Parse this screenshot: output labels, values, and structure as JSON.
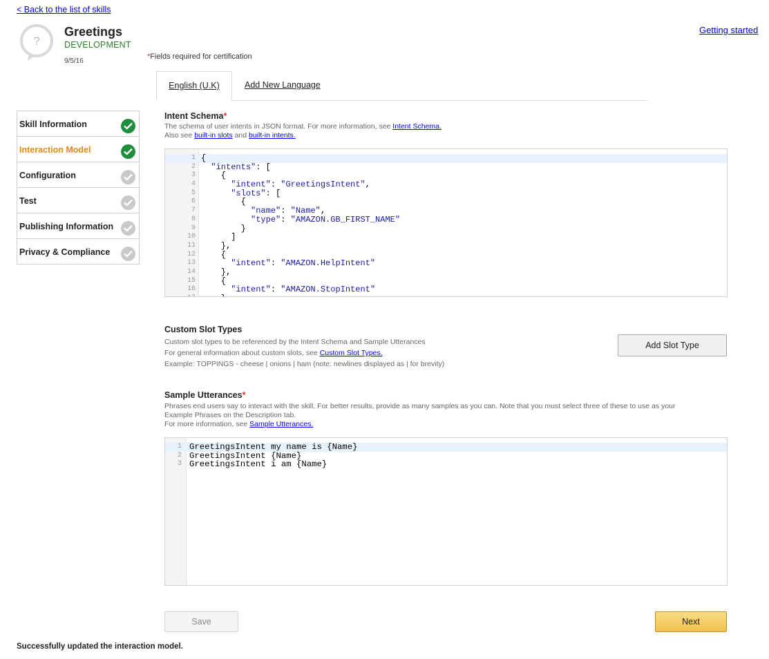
{
  "header": {
    "back_link": "< Back to the list of skills",
    "skill_name": "Greetings",
    "skill_status": "DEVELOPMENT",
    "skill_date": "9/5/16",
    "getting_started": "Getting started",
    "required_mark": "*",
    "required_note": "Fields required for certification"
  },
  "language_tabs": [
    {
      "label": "English (U.K)",
      "active": true
    },
    {
      "label": "Add New Language",
      "active": false
    }
  ],
  "sidebar": {
    "items": [
      {
        "label": "Skill Information",
        "status": "complete"
      },
      {
        "label": "Interaction Model",
        "status": "complete",
        "active": true
      },
      {
        "label": "Configuration",
        "status": "incomplete"
      },
      {
        "label": "Test",
        "status": "incomplete"
      },
      {
        "label": "Publishing Information",
        "status": "incomplete"
      },
      {
        "label": "Privacy & Compliance",
        "status": "incomplete"
      }
    ]
  },
  "intent_schema": {
    "title": "Intent Schema",
    "required_mark": "*",
    "desc1_text": "The schema of user intents in JSON format. For more information, see ",
    "desc1_link": "Intent Schema.",
    "desc2_prefix": "Also see ",
    "desc2_link1": "built-in slots",
    "desc2_mid": " and ",
    "desc2_link2": "built-in intents.",
    "lines": [
      "{",
      "  \"intents\": [",
      "    {",
      "      \"intent\": \"GreetingsIntent\",",
      "      \"slots\": [",
      "        {",
      "          \"name\": \"Name\",",
      "          \"type\": \"AMAZON.GB_FIRST_NAME\"",
      "        }",
      "      ]",
      "    },",
      "    {",
      "      \"intent\": \"AMAZON.HelpIntent\"",
      "    },",
      "    {",
      "      \"intent\": \"AMAZON.StopIntent\"",
      "    }"
    ]
  },
  "custom_slots": {
    "title": "Custom Slot Types",
    "desc1": "Custom slot types to be referenced by the Intent Schema and Sample Utterances",
    "desc2_text": "For general information about custom slots, see ",
    "desc2_link": "Custom Slot Types.",
    "desc3": "Example: TOPPINGS - cheese | onions | ham (note: newlines displayed as | for brevity)",
    "add_button": "Add Slot Type"
  },
  "sample_utterances": {
    "title": "Sample Utterances",
    "required_mark": "*",
    "desc1": "Phrases end users say to interact with the skill. For better results, provide as many samples as you can. Note that you must select three of these to use as your",
    "desc2": "Example Phrases on the Description tab.",
    "desc3_text": "For more information, see ",
    "desc3_link": "Sample Utterances.",
    "lines": [
      "GreetingsIntent my name is {Name}",
      "GreetingsIntent {Name}",
      "GreetingsIntent i am {Name}"
    ]
  },
  "footer": {
    "save_label": "Save",
    "next_label": "Next",
    "status_message": "Successfully updated the interaction model."
  },
  "colors": {
    "accent_orange": "#e08a16",
    "status_green": "#2a7d2a",
    "check_green": "#1d8f3c",
    "next_yellow": "#f0c14b"
  }
}
